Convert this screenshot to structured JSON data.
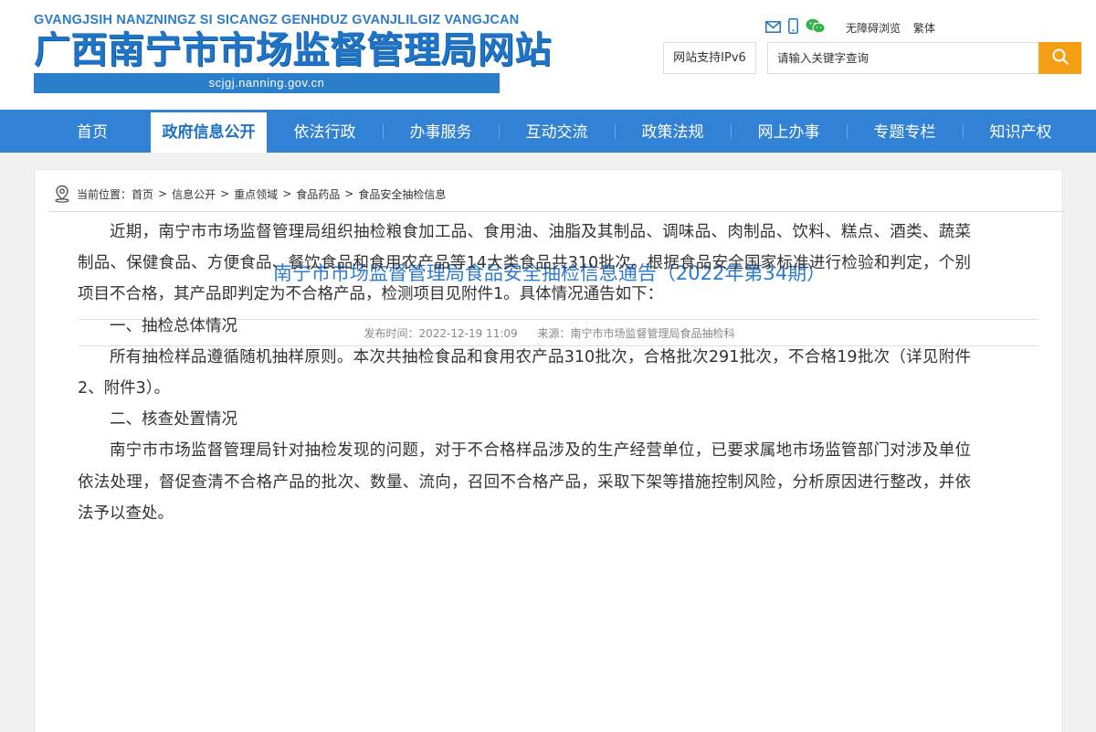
{
  "header": {
    "logo_pinyin": "GVANGJSIH NANZNINGZ SI SICANGZ GENHDUZ GVANJLILGIZ VANGJCAN",
    "logo_title": "广西南宁市市场监督管理局网站",
    "logo_url": "scjgj.nanning.gov.cn",
    "accessibility_label": "无障碍浏览",
    "traditional_label": "繁体",
    "ipv6_label": "网站支持IPv6",
    "search_placeholder": "请输入关键字查询",
    "icons": [
      "mail-icon",
      "mobile-icon",
      "wechat-icon",
      "search-icon"
    ],
    "accent_color": "#f5a014"
  },
  "nav": {
    "items": [
      "首页",
      "政府信息公开",
      "依法行政",
      "办事服务",
      "互动交流",
      "政策法规",
      "网上办事",
      "专题专栏",
      "知识产权"
    ],
    "active_index": 1,
    "background_color": "#3181d5"
  },
  "breadcrumb": {
    "label": "当前位置：",
    "items": [
      "首页",
      "信息公开",
      "重点领域",
      "食品药品",
      "食品安全抽检信息"
    ],
    "separator": ">"
  },
  "article": {
    "title": "南宁市市场监督管理局食品安全抽检信息通告（2022年第34期）",
    "publish_time": "发布时间：2022-12-19 11:09",
    "source": "来源：南宁市市场监督管理局食品抽检科",
    "paragraphs": [
      "近期，南宁市市场监督管理局组织抽检粮食加工品、食用油、油脂及其制品、调味品、肉制品、饮料、糕点、酒类、蔬菜制品、保健食品、方便食品、餐饮食品和食用农产品等14大类食品共310批次。根据食品安全国家标准进行检验和判定，个别项目不合格，其产品即判定为不合格产品，检测项目见附件1。具体情况通告如下：",
      "一、抽检总体情况",
      "所有抽检样品遵循随机抽样原则。本次共抽检食品和食用农产品310批次，合格批次291批次，不合格19批次（详见附件2、附件3）。",
      "二、核查处置情况",
      "南宁市市场监督管理局针对抽检发现的问题，对于不合格样品涉及的生产经营单位，已要求属地市场监管部门对涉及单位依法处理，督促查清不合格产品的批次、数量、流向，召回不合格产品，采取下架等措施控制风险，分析原因进行整改，并依法予以查处。"
    ]
  }
}
